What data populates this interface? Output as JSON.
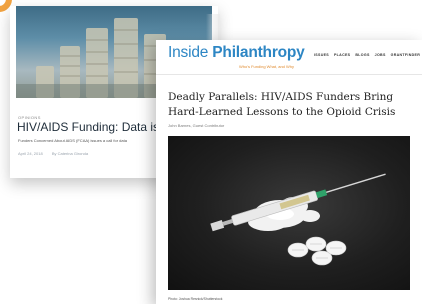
{
  "back_card": {
    "tag": "OPINIONS",
    "title": "HIV/AIDS Funding: Data is th",
    "subtitle": "Funders Concerned About AIDS (FCAA) issues a call for data",
    "date": "April 24, 2018",
    "author": "By Caterina Gironda"
  },
  "front_card": {
    "logo_word1": "Inside ",
    "logo_word2": "Philanthropy",
    "tagline": "Who's Funding What, and Why",
    "nav": [
      "ISSUES",
      "PLACES",
      "BLOGS",
      "JOBS",
      "GRANTFINDER"
    ],
    "article_title": "Deadly Parallels: HIV/AIDS Funders Bring Hard-Learned Lessons to the Opioid Crisis",
    "byline": "John Barnes, Guest Contributor",
    "photo_credit": "Photo: Joshua Resnick/Shutterstock"
  },
  "colors": {
    "accent_orange": "#f2a341",
    "brand_blue": "#2d86c4"
  }
}
